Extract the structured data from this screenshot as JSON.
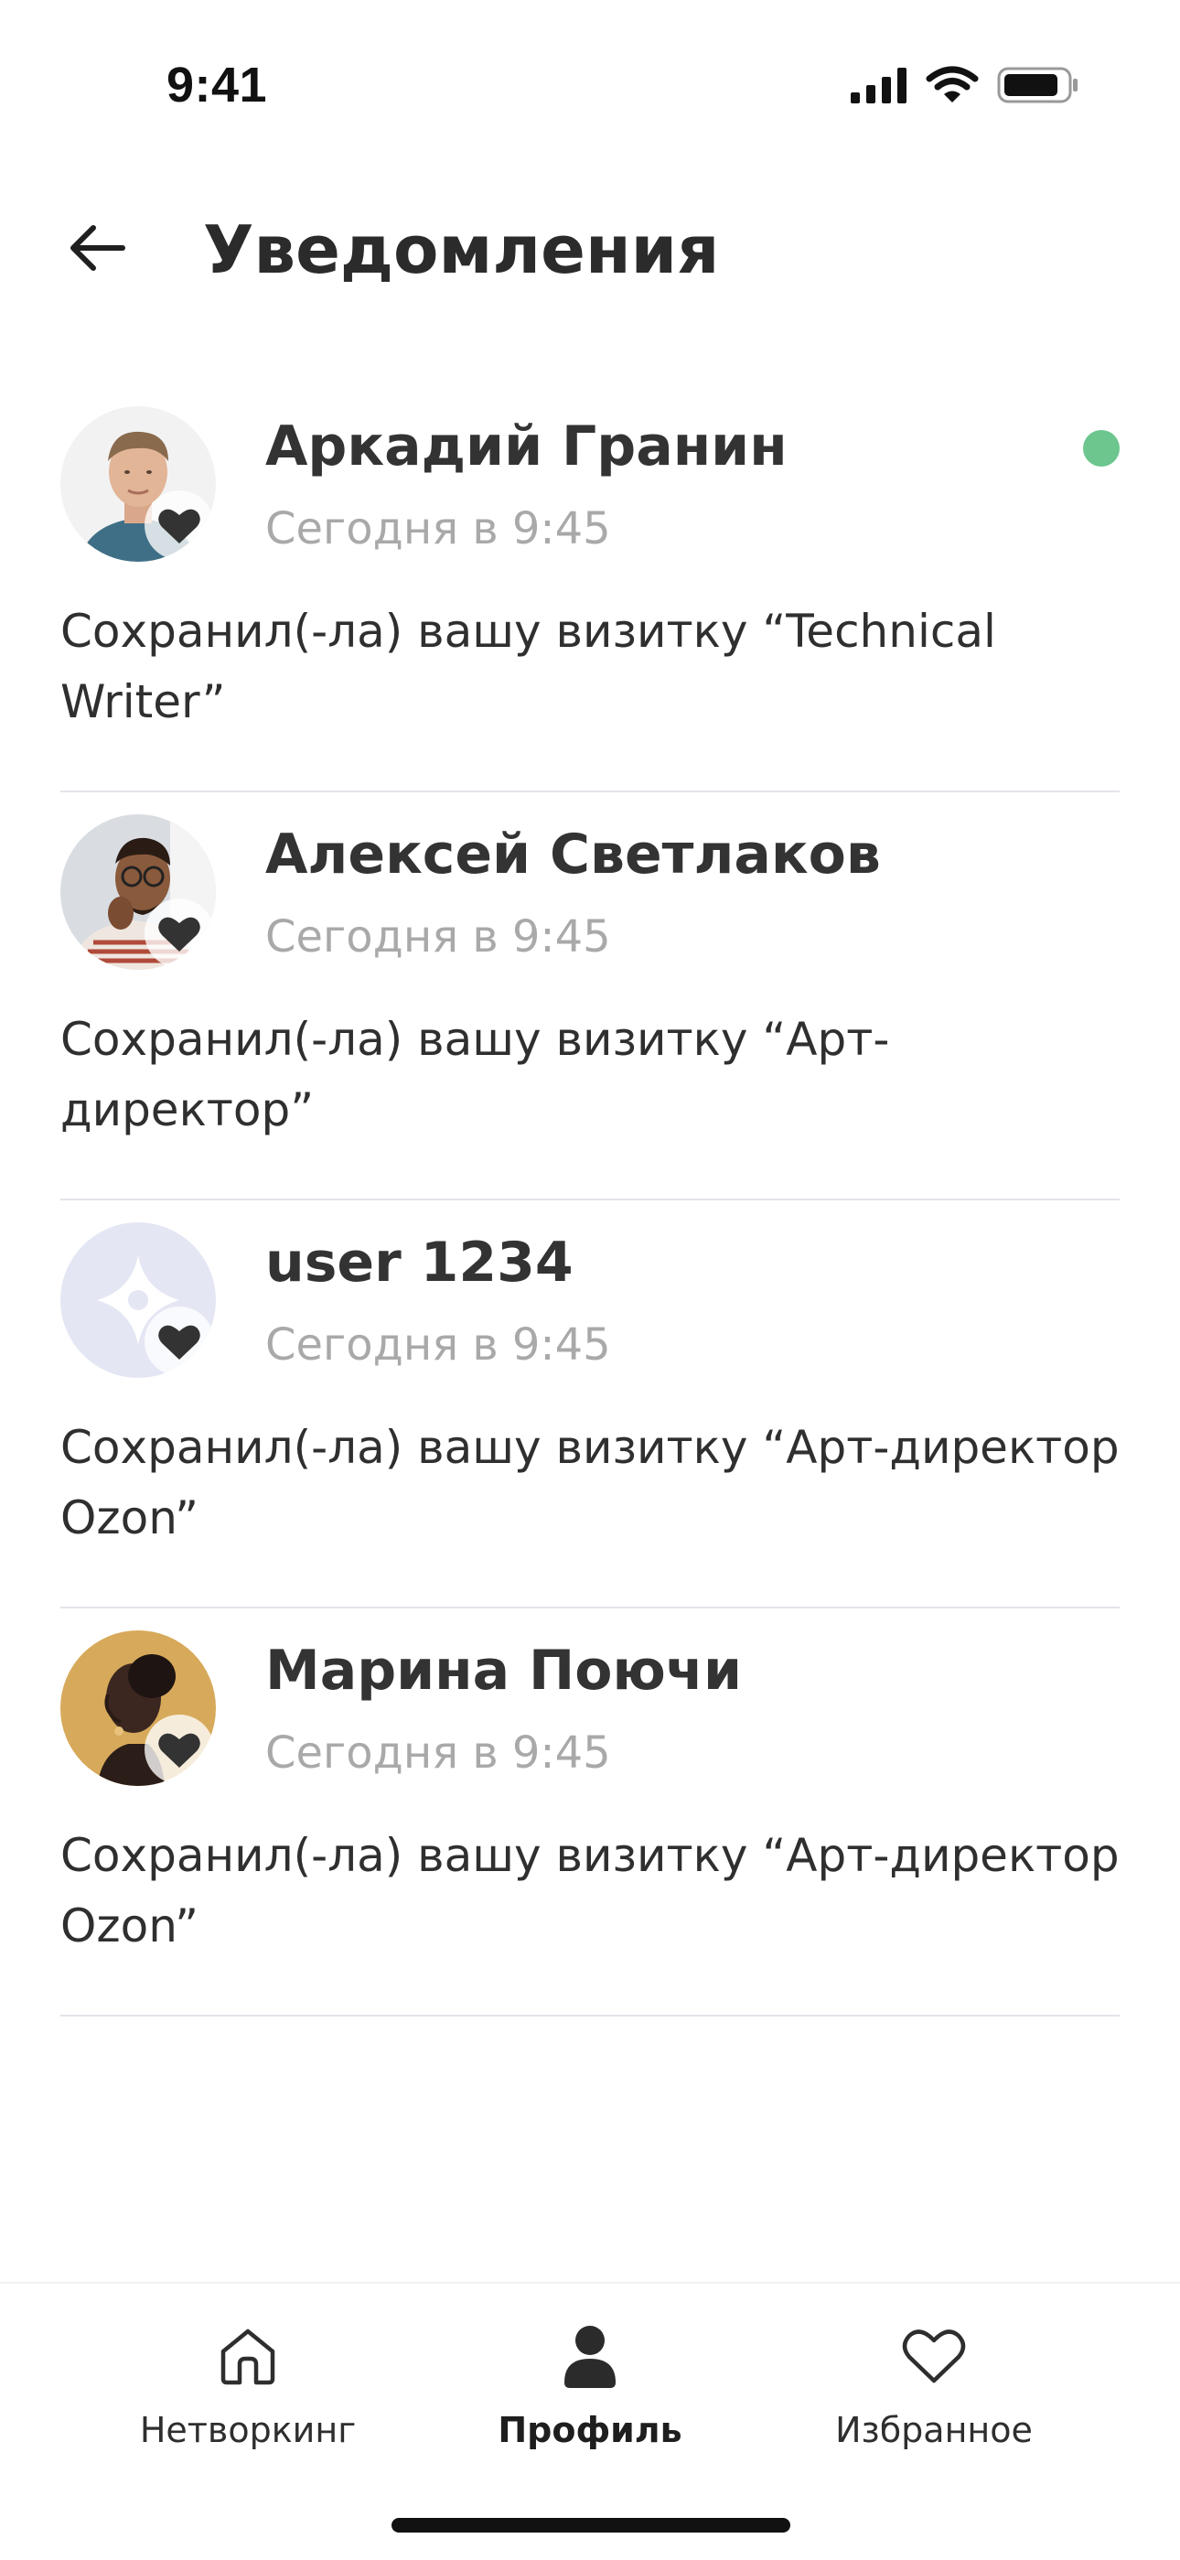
{
  "status_bar": {
    "time": "9:41"
  },
  "header": {
    "title": "Уведомления"
  },
  "notifications": [
    {
      "name": "Аркадий Гранин",
      "time": "Сегодня в 9:45",
      "text": "Сохранил(-ла) вашу визитку “Technical Writer”",
      "unread": true,
      "avatar": "photo-man-blue-shirt"
    },
    {
      "name": "Алексей Светлаков",
      "time": "Сегодня в 9:45",
      "text": "Сохранил(-ла) вашу визитку “Арт-директор”",
      "unread": false,
      "avatar": "photo-man-glasses"
    },
    {
      "name": "user 1234",
      "time": "Сегодня в 9:45",
      "text": "Сохранил(-ла) вашу визитку “Арт-директор Ozon”",
      "unread": false,
      "avatar": "placeholder-star"
    },
    {
      "name": "Марина Поючи",
      "time": "Сегодня в 9:45",
      "text": "Сохранил(-ла) вашу визитку “Арт-директор Ozon”",
      "unread": false,
      "avatar": "photo-woman-gold"
    }
  ],
  "bottom_nav": {
    "items": [
      {
        "label": "Нетворкинг",
        "icon": "home-icon",
        "active": false
      },
      {
        "label": "Профиль",
        "icon": "profile-icon",
        "active": true
      },
      {
        "label": "Избранное",
        "icon": "heart-icon",
        "active": false
      }
    ]
  },
  "colors": {
    "unread_dot": "#6cc68e",
    "divider": "#e3e4ea",
    "time_text": "#a9a9a9",
    "placeholder_avatar_bg": "#e4e7f3"
  }
}
